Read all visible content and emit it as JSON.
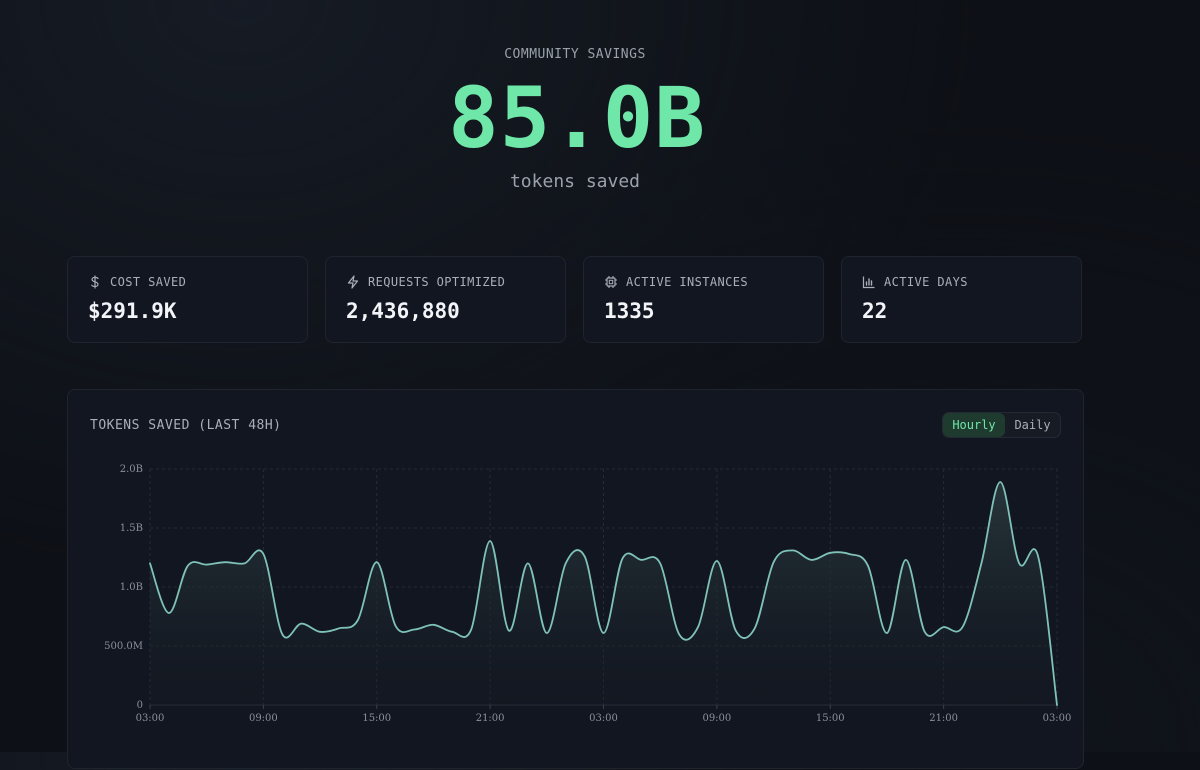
{
  "hero": {
    "label": "COMMUNITY SAVINGS",
    "value": "85.0B",
    "unit": "tokens saved"
  },
  "stats": [
    {
      "label": "COST SAVED",
      "value": "$291.9K",
      "icon": "dollar-icon"
    },
    {
      "label": "REQUESTS OPTIMIZED",
      "value": "2,436,880",
      "icon": "lightning-icon"
    },
    {
      "label": "ACTIVE INSTANCES",
      "value": "1335",
      "icon": "chip-icon"
    },
    {
      "label": "ACTIVE DAYS",
      "value": "22",
      "icon": "bar-chart-icon"
    }
  ],
  "chart_card": {
    "title": "TOKENS SAVED (LAST 48H)",
    "toggle": {
      "hourly": "Hourly",
      "daily": "Daily",
      "selected": "Hourly"
    }
  },
  "colors": {
    "accent": "#6ee7a8",
    "line": "#7fc2b8",
    "background": "#0d1016",
    "card": "#121620"
  },
  "chart_data": {
    "type": "area",
    "title": "TOKENS SAVED (LAST 48H)",
    "xlabel": "",
    "ylabel": "",
    "ylim": [
      0,
      2000000000
    ],
    "yticks": [
      {
        "value": 0,
        "label": "0"
      },
      {
        "value": 500000000,
        "label": "500.0M"
      },
      {
        "value": 1000000000,
        "label": "1.0B"
      },
      {
        "value": 1500000000,
        "label": "1.5B"
      },
      {
        "value": 2000000000,
        "label": "2.0B"
      }
    ],
    "xtick_labels": [
      "03:00",
      "09:00",
      "15:00",
      "21:00",
      "03:00",
      "09:00",
      "15:00",
      "21:00",
      "03:00"
    ],
    "grid": true,
    "series": [
      {
        "values": [
          1200000000,
          780000000,
          1180000000,
          1190000000,
          1210000000,
          1200000000,
          1280000000,
          600000000,
          690000000,
          620000000,
          650000000,
          720000000,
          1210000000,
          670000000,
          640000000,
          680000000,
          620000000,
          640000000,
          1390000000,
          630000000,
          1200000000,
          610000000,
          1200000000,
          1260000000,
          610000000,
          1240000000,
          1230000000,
          1200000000,
          600000000,
          660000000,
          1220000000,
          630000000,
          650000000,
          1210000000,
          1310000000,
          1230000000,
          1290000000,
          1280000000,
          1180000000,
          610000000,
          1230000000,
          620000000,
          660000000,
          660000000,
          1200000000,
          1890000000,
          1200000000,
          1260000000,
          0
        ]
      }
    ]
  }
}
